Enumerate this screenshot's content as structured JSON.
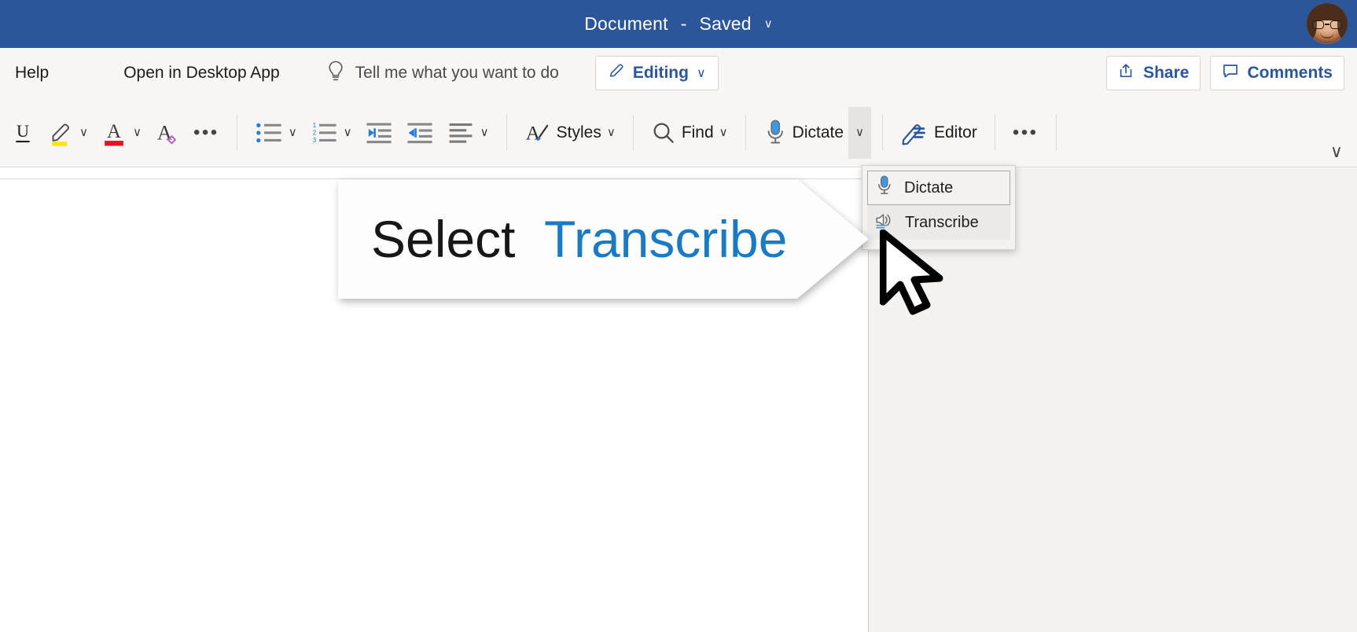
{
  "titlebar": {
    "document_title": "Document",
    "separator": "-",
    "save_state": "Saved",
    "chevron": "∨",
    "avatar_name": "user-avatar"
  },
  "commandbar": {
    "help": "Help",
    "open_in_desktop_app": "Open in Desktop App",
    "tell_me": "Tell me what you want to do",
    "tell_me_icon": "lightbulb-icon",
    "editing": {
      "label": "Editing",
      "icon": "pencil-icon",
      "chevron": "∨"
    },
    "share": {
      "label": "Share",
      "icon": "share-icon"
    },
    "comments": {
      "label": "Comments",
      "icon": "comment-icon"
    }
  },
  "ribbon": {
    "underline": {
      "name": "underline-icon",
      "glyph": "U"
    },
    "highlight": {
      "name": "text-highlight-icon",
      "color": "#ffe600",
      "chevron": "∨"
    },
    "font_color": {
      "name": "font-color-icon",
      "glyph": "A",
      "color": "#e81123",
      "chevron": "∨"
    },
    "clear_formatting": {
      "name": "clear-formatting-icon",
      "glyph": "A"
    },
    "more_font": {
      "name": "more-font-options-icon",
      "glyph": "•••"
    },
    "bullets": {
      "name": "bulleted-list-icon",
      "chevron": "∨"
    },
    "numbering": {
      "name": "numbered-list-icon",
      "chevron": "∨"
    },
    "decrease_indent": {
      "name": "decrease-indent-icon"
    },
    "increase_indent": {
      "name": "increase-indent-icon"
    },
    "alignment": {
      "name": "align-left-icon",
      "chevron": "∨"
    },
    "styles": {
      "label": "Styles",
      "icon": "styles-icon",
      "chevron": "∨"
    },
    "find": {
      "label": "Find",
      "icon": "search-icon",
      "chevron": "∨"
    },
    "dictate": {
      "label": "Dictate",
      "icon": "microphone-icon",
      "chevron": "∨"
    },
    "editor": {
      "label": "Editor",
      "icon": "editor-pen-icon"
    },
    "overflow": {
      "name": "ribbon-overflow-icon",
      "glyph": "•••"
    },
    "collapse": {
      "name": "collapse-ribbon-chevron-icon",
      "glyph": "∨"
    }
  },
  "dictate_menu": {
    "items": [
      {
        "label": "Dictate",
        "icon": "microphone-icon",
        "state": "selected"
      },
      {
        "label": "Transcribe",
        "icon": "transcribe-audio-icon",
        "state": "hover"
      }
    ]
  },
  "callout": {
    "prefix": "Select",
    "highlight_word": "Transcribe",
    "highlight_color": "#1a7ac4",
    "text_color": "#171717"
  },
  "cursor": {
    "name": "mouse-pointer"
  }
}
